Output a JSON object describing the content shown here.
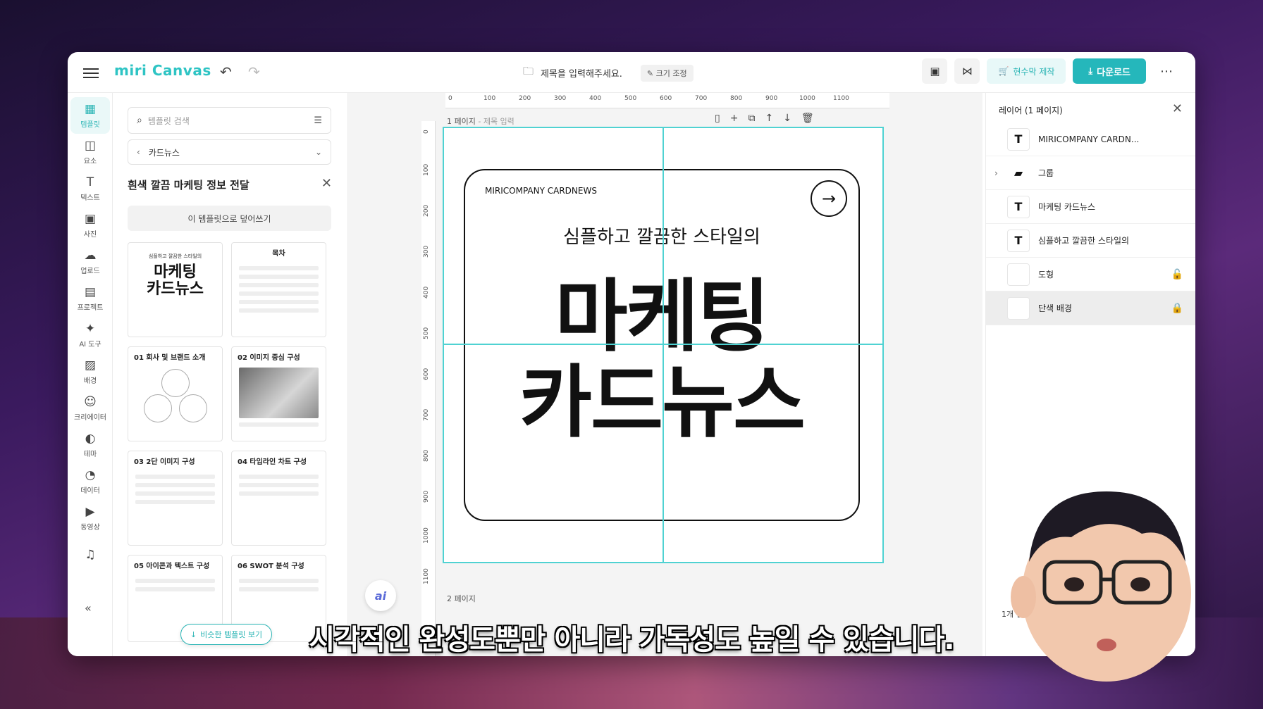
{
  "app": {
    "logo": "miri Canvas",
    "doc_title_placeholder": "제목을 입력해주세요.",
    "resize_label": "크기 조정",
    "print_label": "현수막 제작",
    "download_label": "다운로드"
  },
  "rail": [
    {
      "label": "템플릿",
      "icon": "▦"
    },
    {
      "label": "요소",
      "icon": "◫"
    },
    {
      "label": "텍스트",
      "icon": "T"
    },
    {
      "label": "사진",
      "icon": "▣"
    },
    {
      "label": "업로드",
      "icon": "☁"
    },
    {
      "label": "프로젝트",
      "icon": "▤"
    },
    {
      "label": "AI 도구",
      "icon": "✦"
    },
    {
      "label": "배경",
      "icon": "▨"
    },
    {
      "label": "크리에이터",
      "icon": "☺"
    },
    {
      "label": "테마",
      "icon": "◐"
    },
    {
      "label": "데이터",
      "icon": "◔"
    },
    {
      "label": "동영상",
      "icon": "▶"
    },
    {
      "label": "",
      "icon": "♫"
    }
  ],
  "panel": {
    "search_placeholder": "템플릿 검색",
    "category": "카드뉴스",
    "template_title": "흰색 깔끔 마케팅 정보 전달",
    "apply_label": "이 템플릿으로 덮어쓰기",
    "similar_label": "비슷한 템플릿 보기",
    "thumbs": {
      "cover_sub": "심플하고 깔끔한 스타일의",
      "cover_big1": "마케팅",
      "cover_big2": "카드뉴스",
      "toc": "목차",
      "t1": "01   회사 및 브랜드 소개",
      "t2": "02   이미지 중심 구성",
      "t3": "03   2단 이미지 구성",
      "t4": "04   타임라인 차트 구성",
      "t5": "05   아이콘과 텍스트 구성",
      "t6": "06   SWOT 분석 구성"
    }
  },
  "canvas": {
    "page1_label": "1 페이지",
    "page1_title": "- 제목 입력",
    "page2_label": "2 페이지",
    "ruler_ticks": [
      "0",
      "100",
      "200",
      "300",
      "400",
      "500",
      "600",
      "700",
      "800",
      "900",
      "1000",
      "1100"
    ],
    "ruler_left_ticks": [
      "0",
      "100",
      "200",
      "300",
      "400",
      "500",
      "600",
      "700",
      "800",
      "900",
      "1000",
      "1100"
    ],
    "card": {
      "brand": "MIRICOMPANY CARDNEWS",
      "subtitle": "심플하고 깔끔한 스타일의",
      "title_line1": "마케팅",
      "title_line2": "카드뉴스"
    },
    "ai_label": "ai"
  },
  "layers": {
    "header": "레이어 (1 페이지)",
    "items": [
      {
        "name": "MIRICOMPANY CARDN...",
        "icon": "T"
      },
      {
        "name": "그룹",
        "icon": "▰"
      },
      {
        "name": "마케팅 카드뉴스",
        "icon": "T"
      },
      {
        "name": "심플하고 깔끔한 스타일의",
        "icon": "T"
      },
      {
        "name": "도형",
        "icon": ""
      },
      {
        "name": "단색 배경",
        "icon": ""
      }
    ],
    "footer": "1개 선택"
  },
  "subtitle": "시각적인 완성도뿐만 아니라 가독성도 높일 수 있습니다."
}
